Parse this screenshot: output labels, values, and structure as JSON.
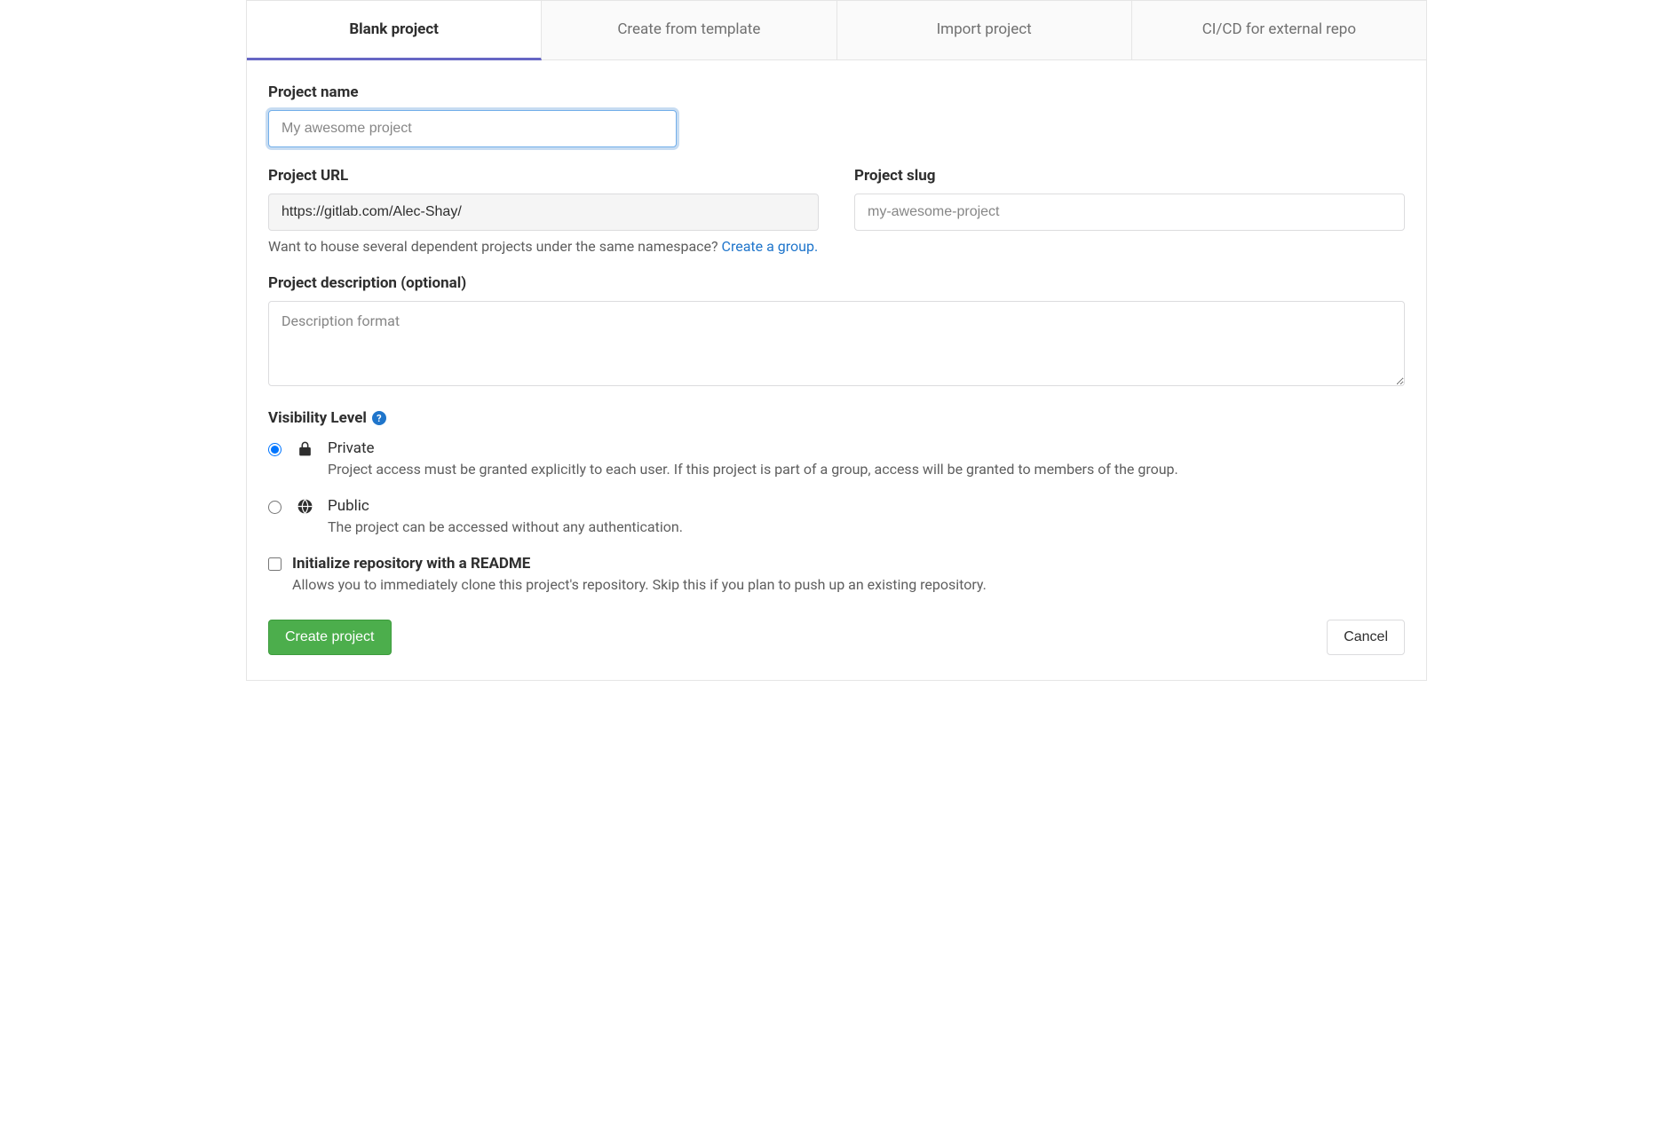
{
  "tabs": [
    {
      "label": "Blank project",
      "active": true
    },
    {
      "label": "Create from template",
      "active": false
    },
    {
      "label": "Import project",
      "active": false
    },
    {
      "label": "CI/CD for external repo",
      "active": false
    }
  ],
  "form": {
    "project_name": {
      "label": "Project name",
      "placeholder": "My awesome project",
      "value": ""
    },
    "project_url": {
      "label": "Project URL",
      "value": "https://gitlab.com/Alec-Shay/"
    },
    "project_slug": {
      "label": "Project slug",
      "placeholder": "my-awesome-project",
      "value": ""
    },
    "namespace_hint": {
      "text_before": "Want to house several dependent projects under the same namespace? ",
      "link_text": "Create a group.",
      "text_after": ""
    },
    "description": {
      "label": "Project description (optional)",
      "placeholder": "Description format",
      "value": ""
    },
    "visibility": {
      "label": "Visibility Level",
      "options": [
        {
          "key": "private",
          "title": "Private",
          "desc": "Project access must be granted explicitly to each user. If this project is part of a group, access will be granted to members of the group.",
          "checked": true
        },
        {
          "key": "public",
          "title": "Public",
          "desc": "The project can be accessed without any authentication.",
          "checked": false
        }
      ]
    },
    "initialize_readme": {
      "title": "Initialize repository with a README",
      "desc": "Allows you to immediately clone this project's repository. Skip this if you plan to push up an existing repository.",
      "checked": false
    },
    "buttons": {
      "submit": "Create project",
      "cancel": "Cancel"
    }
  }
}
